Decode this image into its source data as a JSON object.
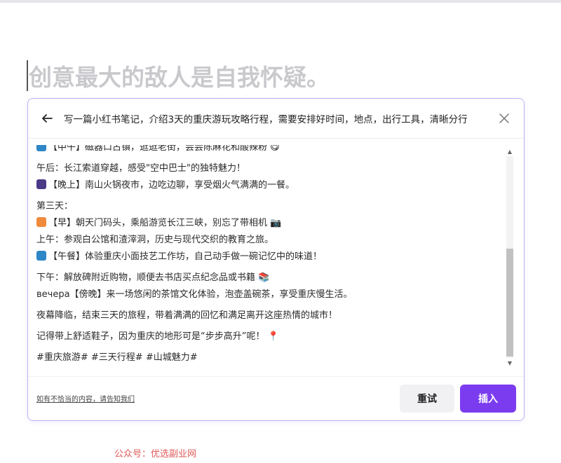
{
  "headline": "创意最大的敌人是自我怀疑。",
  "dialog": {
    "prompt": "写一篇小红书笔记，介绍3天的重庆游玩攻略行程，需要安排好时间，地点，出行工具，清晰分行",
    "content_lines": [
      {
        "text": "【中午】磁器口古镇，逛逛老街，尝尝陈麻花和酸辣粉 😋",
        "emoji_color": "#2f86c7"
      },
      {
        "text": "午后：长江索道穿越，感受\"空中巴士\"的独特魅力！",
        "emoji_color": ""
      },
      {
        "text": "【晚上】南山火锅夜市，边吃边聊，享受烟火气满满的一餐。",
        "emoji_color": "#4b3a86"
      },
      {
        "text": "第三天：",
        "emoji_color": ""
      },
      {
        "text": "【早】朝天门码头，乘船游览长江三峡，别忘了带相机 📷",
        "emoji_color": "#f08a3c"
      },
      {
        "text": "上午：参观白公馆和渣滓洞，历史与现代交织的教育之旅。",
        "emoji_color": ""
      },
      {
        "text": "【午餐】体验重庆小面技艺工作坊，自己动手做一碗记忆中的味道！",
        "emoji_color": "#2f86c7"
      },
      {
        "text": "下午：解放碑附近购物，顺便去书店买点纪念品或书籍 📚",
        "emoji_color": ""
      },
      {
        "text": "вечера【傍晚】来一场悠闲的茶馆文化体验，泡壶盖碗茶，享受重庆慢生活。",
        "emoji_color": ""
      },
      {
        "text": "夜幕降临，结束三天的旅程，带着满满的回忆和满足离开这座热情的城市！",
        "emoji_color": ""
      },
      {
        "text": "记得带上舒适鞋子，因为重庆的地形可是“步步高升”呢！ 📍",
        "emoji_color": ""
      },
      {
        "text": "#重庆旅游# #三天行程# #山城魅力#",
        "emoji_color": ""
      }
    ],
    "report_link": "如有不恰当的内容，请告知我们",
    "retry_label": "重试",
    "insert_label": "插入"
  },
  "watermark": "公众号：优选副业网",
  "colors": {
    "accent": "#7b3cf0",
    "border": "#b9b2f0",
    "headline": "#c9c9cd"
  },
  "icons": {
    "back": "arrow-left-icon",
    "close": "close-icon",
    "scroll_up": "caret-up-icon",
    "scroll_down": "caret-down-icon"
  }
}
